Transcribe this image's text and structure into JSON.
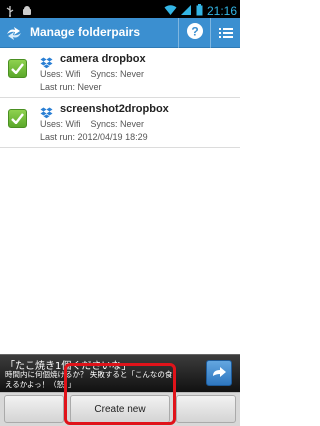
{
  "status_bar": {
    "time": "21:16",
    "icons": [
      "usb-icon",
      "android-debug-icon",
      "wifi-icon",
      "signal-icon",
      "battery-icon"
    ]
  },
  "action_bar": {
    "title": "Manage folderpairs",
    "app_icon": "dropsync-icon",
    "help_icon": "help-icon",
    "menu_icon": "list-icon",
    "color": "#3b8fd0"
  },
  "folderpairs": [
    {
      "name": "camera dropbox",
      "uses": "Uses: Wifi",
      "syncs": "Syncs: Never",
      "last_run": "Last run: Never",
      "checked": true
    },
    {
      "name": "screenshot2dropbox",
      "uses": "Uses: Wifi",
      "syncs": "Syncs: Never",
      "last_run": "Last run: 2012/04/19 18:29",
      "checked": true
    }
  ],
  "ad": {
    "headline": "「たこ焼き1個くださいな」",
    "body": "時間内に何個焼けるか？ 失敗すると「こんなの食えるかよっ！（怒）」"
  },
  "bottom": {
    "create_label": "Create new",
    "highlight_color": "#e0131a"
  }
}
